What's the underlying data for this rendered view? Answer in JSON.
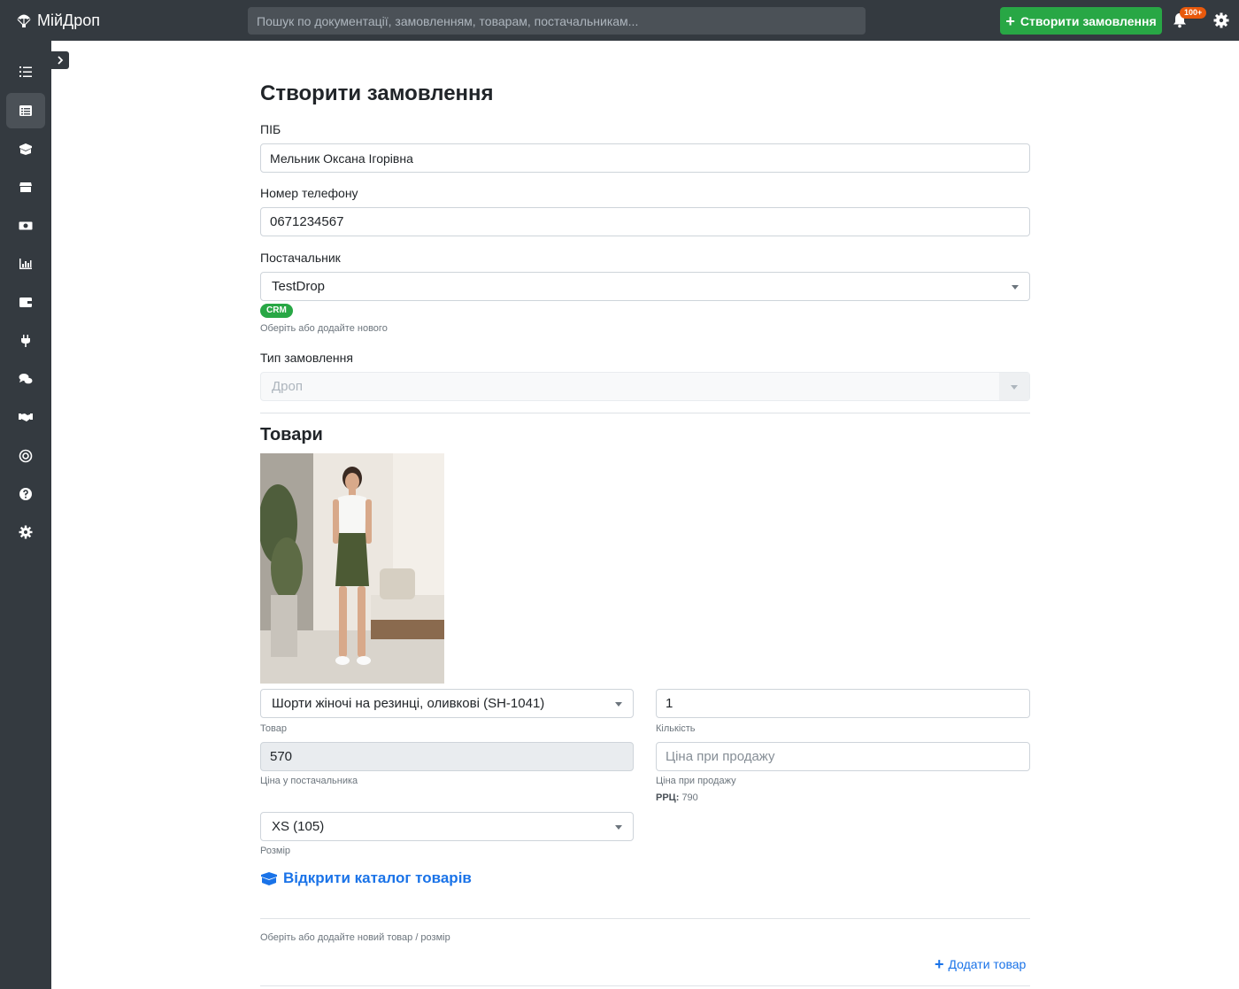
{
  "header": {
    "brand": "МійДроп",
    "search_placeholder": "Пошук по документації, замовленням, товарам, постачальникам...",
    "create_button": "Створити замовлення",
    "notifications_badge": "100+"
  },
  "sidebar": {
    "items": [
      {
        "icon": "tasks-icon"
      },
      {
        "icon": "orders-list-icon",
        "active": true
      },
      {
        "icon": "boxes-icon"
      },
      {
        "icon": "store-icon"
      },
      {
        "icon": "money-icon"
      },
      {
        "icon": "chart-icon"
      },
      {
        "icon": "wallet-icon"
      },
      {
        "icon": "plug-icon"
      },
      {
        "icon": "chat-icon"
      },
      {
        "icon": "handshake-icon"
      },
      {
        "icon": "openai-icon"
      },
      {
        "icon": "help-icon"
      },
      {
        "icon": "settings-icon"
      }
    ]
  },
  "form": {
    "title": "Створити замовлення",
    "name_label": "ПІБ",
    "name_value": "Мельник Оксана Ігорівна",
    "phone_label": "Номер телефону",
    "phone_value": "0671234567",
    "supplier_label": "Постачальник",
    "supplier_value": "TestDrop",
    "supplier_badge": "CRM",
    "supplier_hint": "Оберіть або додайте нового",
    "order_type_label": "Тип замовлення",
    "order_type_value": "Дроп"
  },
  "products": {
    "title": "Товари",
    "product_value": "Шорти жіночі на резинці, оливкові (SH-1041)",
    "product_hint": "Товар",
    "quantity_value": "1",
    "quantity_hint": "Кількість",
    "supplier_price_value": "570",
    "supplier_price_hint": "Ціна у постачальника",
    "sale_price_placeholder": "Ціна при продажу",
    "sale_price_hint": "Ціна при продажу",
    "rrc_label": "РРЦ:",
    "rrc_value": "790",
    "size_value": "XS (105)",
    "size_hint": "Розмір",
    "catalog_link": "Відкрити каталог товарів",
    "add_hint": "Оберіть або додайте новий товар / розмір",
    "add_button": "Додати товар"
  },
  "colors": {
    "topbar": "#343a40",
    "accent_green": "#28a745",
    "link_blue": "#1a73e8",
    "badge_orange": "#e8590c"
  }
}
